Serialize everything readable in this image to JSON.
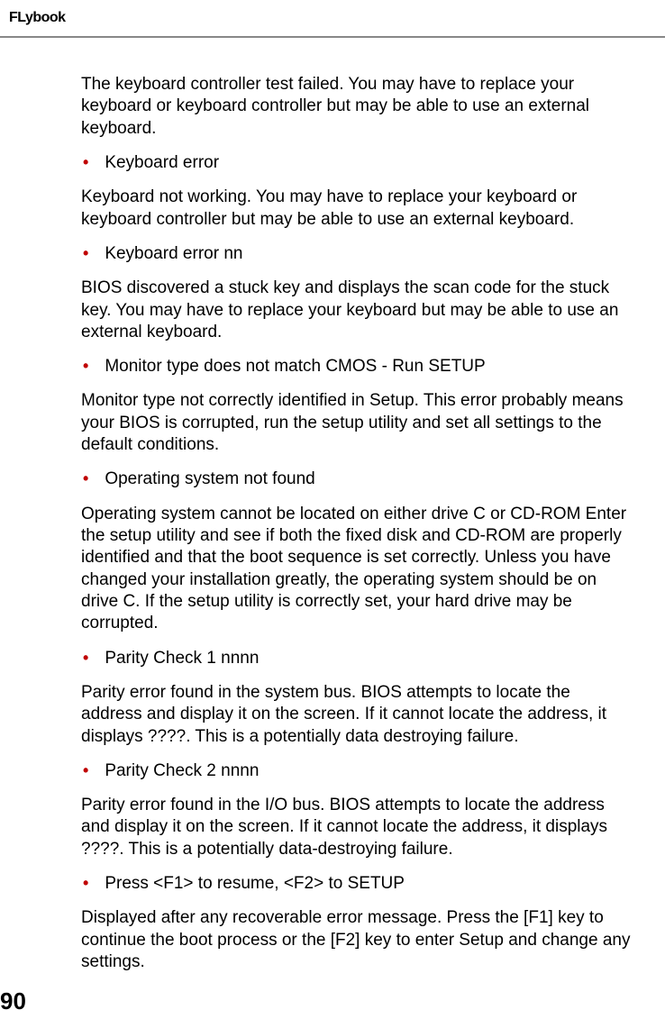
{
  "header": {
    "logo_text": "Flybook"
  },
  "content": {
    "intro": "The keyboard controller test failed. You may have to replace your keyboard or keyboard controller but may be able to use an external keyboard.",
    "items": [
      {
        "bullet": "Keyboard error",
        "desc": "Keyboard not working. You may have to replace your keyboard or keyboard controller but may be able to use an external keyboard."
      },
      {
        "bullet": "Keyboard error nn",
        "desc": "BIOS discovered a stuck key and displays the scan code for the stuck key. You may have to replace your keyboard but may be able to use an external keyboard."
      },
      {
        "bullet": "Monitor type does not match CMOS - Run SETUP",
        "desc": "Monitor type not correctly identified in Setup. This error probably means your BIOS is corrupted, run the setup utility and set all settings to the default conditions."
      },
      {
        "bullet": "Operating system not found",
        "desc": "Operating system cannot be located on either drive C or CD-ROM Enter the setup utility and see if both the fixed disk and CD-ROM are properly identified and that the boot sequence is set correctly. Unless you have changed your installation greatly, the operating system should be on drive C. If the setup utility is correctly set, your hard drive may be corrupted."
      },
      {
        "bullet": "Parity Check 1 nnnn",
        "desc": "Parity error found in the system bus. BIOS attempts to locate the address and display it on the screen. If it cannot locate the address, it displays ????. This is a potentially data destroying failure."
      },
      {
        "bullet": "Parity Check 2 nnnn",
        "desc": "Parity error found in the I/O bus. BIOS attempts to locate the address and display it on the screen. If it cannot locate the address, it displays ????. This is a potentially data-destroying failure."
      },
      {
        "bullet": "Press <F1> to resume, <F2> to SETUP",
        "desc": "Displayed after any recoverable error message. Press the [F1] key to continue the boot process or the [F2] key to enter Setup and change any settings."
      }
    ]
  },
  "page_number": "90"
}
